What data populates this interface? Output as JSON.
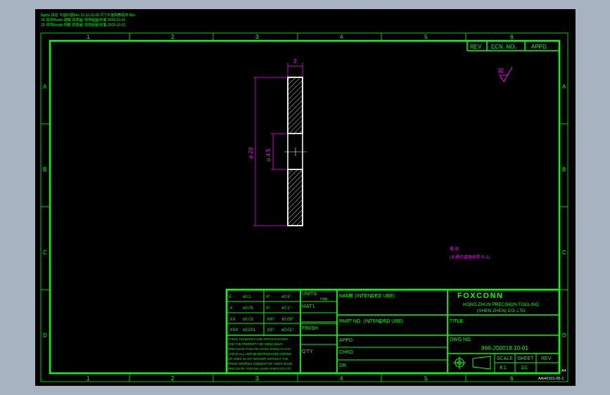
{
  "header_notes": [
    "Name 檔名 平面料號Rev 10.16.30.08 尺寸平面對應程序 Rev",
    "3D 標準Model 建模 標準圖/ 標準組圖/作業 2009-10-01",
    "2D 標準Model 規範 標準圖/ 標準組圖/作業 2009-10-01"
  ],
  "column_numbers": [
    "1",
    "2",
    "3",
    "4",
    "5",
    "6"
  ],
  "row_letters": [
    "A",
    "B",
    "C",
    "D"
  ],
  "revision_block": {
    "rev": "REV",
    "ecn": "ECN. NO.",
    "appd": "APPD."
  },
  "surface_roughness": "32",
  "dimensions": {
    "thickness": "2",
    "outer_diameter": "φ 20",
    "inner_diameter": "φ 4.5"
  },
  "note_text": [
    "備 註",
    "(未標示處理依照 R-1)"
  ],
  "tolerance_table": {
    "rows": [
      {
        "lin": "X",
        "lin_tol": "±0.1",
        "ang": "X°",
        "ang_tol": "±0.5°"
      },
      {
        "lin": ".X",
        "lin_tol": "±0.05",
        "ang": "X°",
        "ang_tol": "±0.1°"
      },
      {
        "lin": ".XX",
        "lin_tol": "±0.01",
        "ang": ".XX°",
        "ang_tol": "±0.05°"
      },
      {
        "lin": ".XXX",
        "lin_tol": "±0.001",
        "ang": ".XX°",
        "ang_tol": "±0.01°"
      }
    ],
    "units_label": "UNITS",
    "units_value": "mm",
    "material_label": "MAT'L",
    "finish_label": "FINISH",
    "qty_label": "Q'TY",
    "legal_note": [
      "THESE DRAWINGS AND SPECIFICATIONS",
      "ARE THE PROPERTY OF HONG ZHUN",
      "PRECISION TOOLING (SHEN ZHEN) CO.LTD",
      "AND SHALL NOT BE REPRODUCED COPIED",
      "OR USED IN ANY MANNER WITHOUT THE",
      "PRIOR WRITTEN CONSENT OF HONG ZHUN",
      "PRECISION TOOLING (SHEN ZHEN) CO.LTD"
    ]
  },
  "title_block": {
    "name_label": "NAME (INTENDED USE)",
    "part_no_label": "PART NO. (INTENDED USE)",
    "appd_label": "APPD.",
    "chkd_label": "CHKD",
    "dr_label": "DR.",
    "company_logo": "FOXCONN",
    "company_name": "HONG ZHUN PRECISION TOOLING",
    "company_sub": "(SHEN ZHEN) CO.,LTD",
    "title_label": "TITLE:",
    "dwg_label": "DWG NO.",
    "dwg_no": "866-JD0018-10-01",
    "scale_label": "SCALE",
    "scale_value": "4:1",
    "sheet_label": "SHEET",
    "sheet_value": "1/1",
    "rev_label": "REV"
  },
  "footer_code": "AAH0101-05-1",
  "corner_mark": "A4"
}
